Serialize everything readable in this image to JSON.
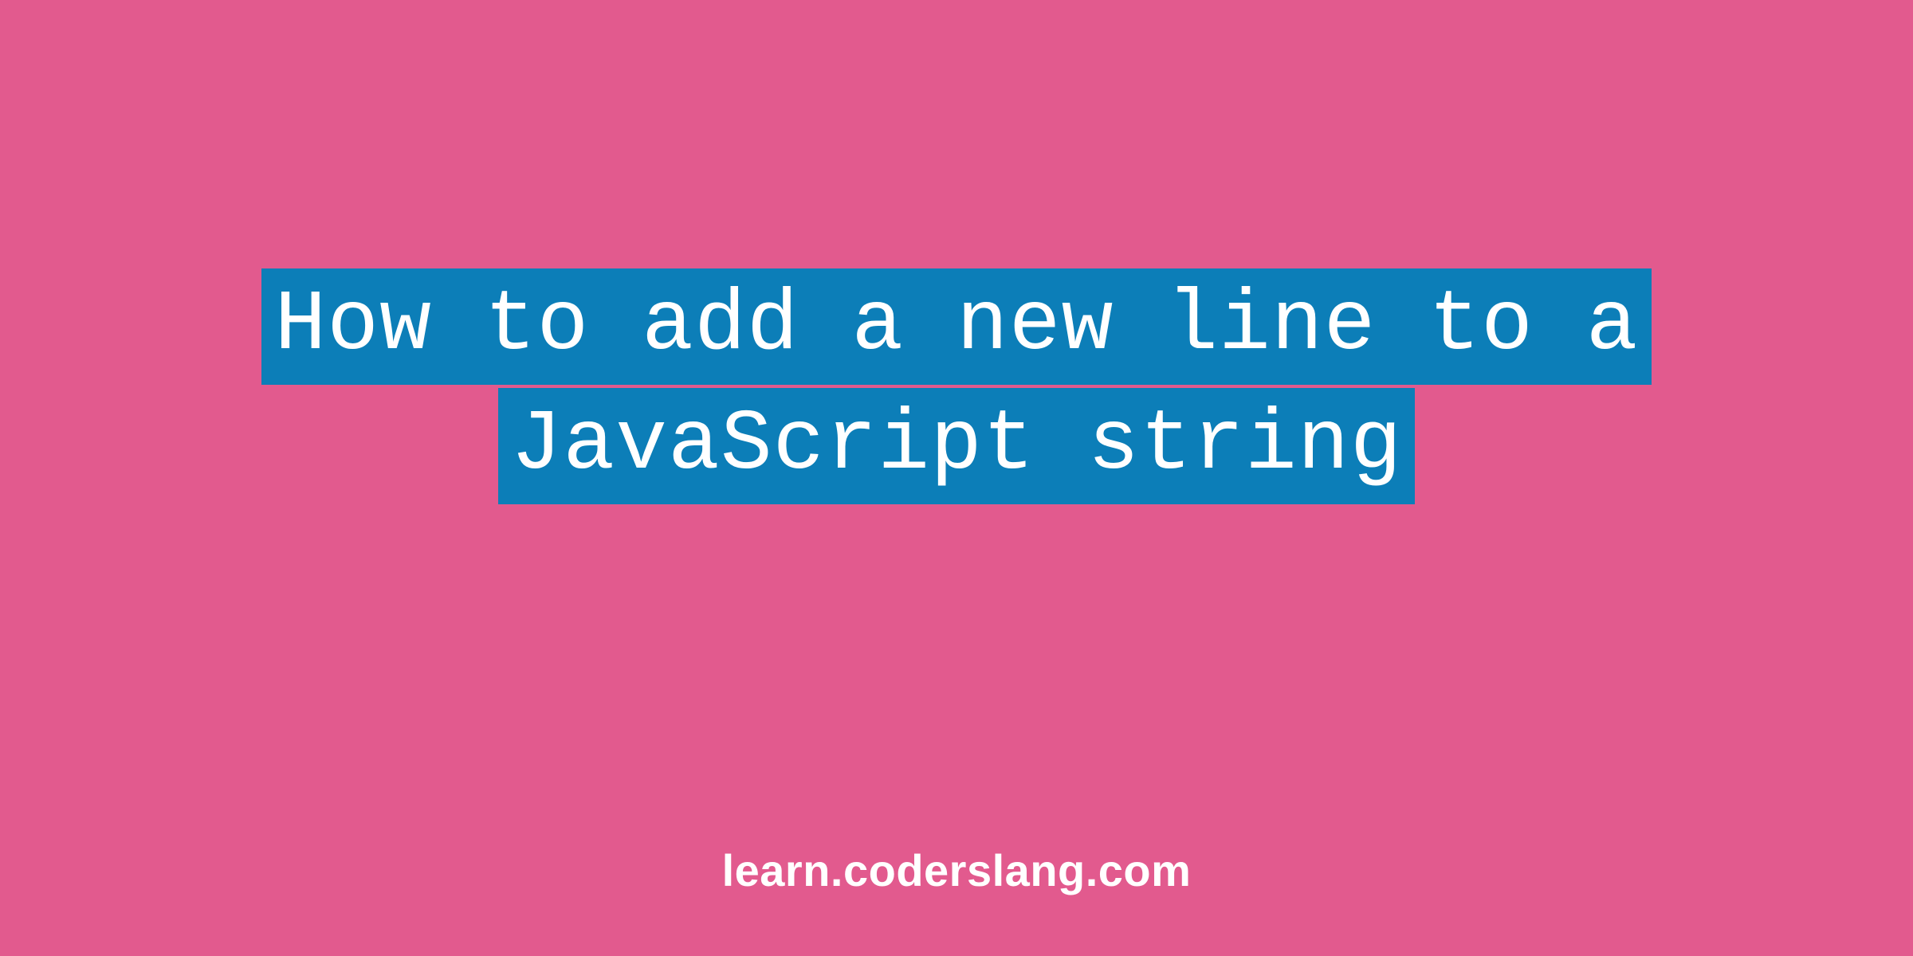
{
  "title": {
    "line1": "How to add a new line to a",
    "line2": "JavaScript string"
  },
  "footer": {
    "domain": "learn.coderslang.com"
  },
  "colors": {
    "background": "#E25A8E",
    "highlight": "#0C7EB8",
    "text": "#FFFFFF"
  }
}
